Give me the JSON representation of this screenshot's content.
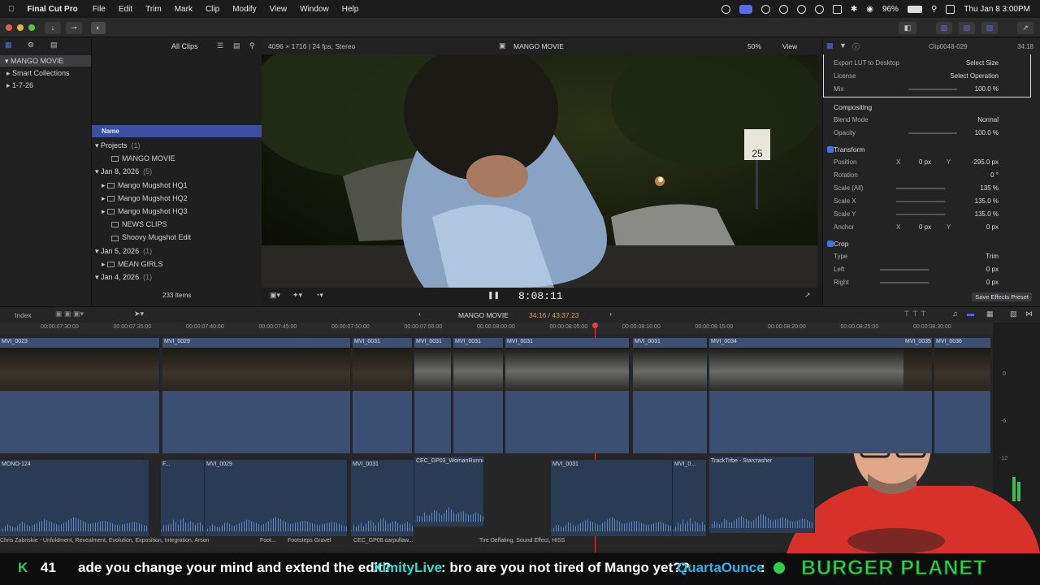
{
  "menubar": {
    "app": "Final Cut Pro",
    "items": [
      "File",
      "Edit",
      "Trim",
      "Mark",
      "Clip",
      "Modify",
      "View",
      "Window",
      "Help"
    ],
    "battery": "96%",
    "datetime": "Thu Jan 8  3:00PM"
  },
  "browser_toolbar": {
    "filter": "All Clips"
  },
  "libraries": [
    {
      "label": "MANGO MOVIE"
    },
    {
      "label": "Smart Collections"
    },
    {
      "label": "1-7-26"
    }
  ],
  "browser": {
    "column_header": "Name",
    "rows": [
      {
        "label": "Projects",
        "count": "(1)",
        "level": 0
      },
      {
        "label": "MANGO MOVIE",
        "count": "",
        "level": 2
      },
      {
        "label": "Jan 8, 2026",
        "count": "(5)",
        "level": 0
      },
      {
        "label": "Mango Mugshot HQ1",
        "count": "",
        "level": 1
      },
      {
        "label": "Mango Mugshot HQ2",
        "count": "",
        "level": 1
      },
      {
        "label": "Mango Mugshot HQ3",
        "count": "",
        "level": 1
      },
      {
        "label": "NEWS CLIPS",
        "count": "",
        "level": 2
      },
      {
        "label": "Shoovy Mugshot Edit",
        "count": "",
        "level": 2
      },
      {
        "label": "Jan 5, 2026",
        "count": "(1)",
        "level": 0
      },
      {
        "label": "MEAN GIRLS",
        "count": "",
        "level": 1
      },
      {
        "label": "Jan 4, 2026",
        "count": "(1)",
        "level": 0
      }
    ],
    "item_count": "233 Items"
  },
  "viewer": {
    "format": "4096 × 1716 | 24 fps, Stereo",
    "title": "MANGO MOVIE",
    "zoom": "50%",
    "view": "View",
    "timecode": "8:08:11",
    "sign": "25"
  },
  "inspector": {
    "clip_name": "Clip0048-029",
    "duration": "34:18",
    "rows_top": [
      {
        "label": "Export LUT to Desktop",
        "value": "Select Size"
      },
      {
        "label": "License",
        "value": "Select Operation"
      },
      {
        "label": "Mix",
        "value": "100.0  %"
      }
    ],
    "compositing": {
      "title": "Compositing",
      "blend_label": "Blend Mode",
      "blend_value": "Normal",
      "opacity_label": "Opacity",
      "opacity_value": "100.0  %"
    },
    "transform": {
      "title": "Transform",
      "position_label": "Position",
      "pos_x": "0  px",
      "pos_y": "-295.0  px",
      "rotation_label": "Rotation",
      "rotation_value": "0  °",
      "scale_all_label": "Scale (All)",
      "scale_all_value": "135  %",
      "scale_x_label": "Scale X",
      "scale_x_value": "135.0  %",
      "scale_y_label": "Scale Y",
      "scale_y_value": "135.0  %",
      "anchor_label": "Anchor",
      "anchor_x": "0  px",
      "anchor_y": "0  px"
    },
    "crop": {
      "title": "Crop",
      "type_label": "Type",
      "type_value": "Trim",
      "left_label": "Left",
      "left_value": "0  px",
      "right_label": "Right",
      "right_value": "0  px"
    },
    "save_preset": "Save Effects Preset"
  },
  "timeline": {
    "index": "Index",
    "project": "MANGO MOVIE",
    "position": "34:16 / 43:37:23",
    "ruler": [
      "00:00:07:30:00",
      "00:00:07:35:00",
      "00:00:07:40:00",
      "00:00:07:45:00",
      "00:00:07:50:00",
      "00:00:07:55:00",
      "00:00:08:00:00",
      "00:00:08:05:00",
      "00:00:08:10:00",
      "00:00:08:15:00",
      "00:00:08:20:00",
      "00:00:08:25:00",
      "00:00:08:30:00"
    ],
    "video_clips": [
      "MVI_0023",
      "MVI_0029",
      "MVI_0031",
      "MVI_0031",
      "MVI_0031",
      "MVI_0031",
      "MVI_0031",
      "MVI_0034",
      "MVI_0035",
      "MVI_0036"
    ],
    "audio_clips": [
      "MONO-124",
      "F...",
      "MVI_0029",
      "MVI_0031",
      "CEC_GP03_WomanRunni...",
      "MVI_0031",
      "MVI_0...",
      "TrackTribe - Starcrasher"
    ],
    "connected": [
      "Chris Zabriskie - Unfoldment, Revealment, Evolution, Exposition, Integration, Arson",
      "Foot...",
      "Footsteps Gravel",
      "CEC_GP08.carpullaw...",
      "Tire Deflating, Sound Effect, HISS"
    ],
    "meter_labels": [
      "0",
      "-6",
      "-12"
    ]
  },
  "chat": {
    "counter_icon": "K",
    "counter": "41",
    "message1": "ade you change your mind and extend the edit?",
    "user2": "XimityLive",
    "message2": ": bro are you not tired of Mango yet??",
    "user3": "QuartaOunce",
    "message3": ":",
    "banner": "BURGER PLANET"
  },
  "colors": {
    "accent": "#5b6ee0",
    "selection": "#3b4ea0",
    "clip_blue": "#3a4f72",
    "playhead": "#e04040",
    "user2": "#2fe0d0",
    "user3": "#27b5f0",
    "banner": "#2dd24a"
  }
}
